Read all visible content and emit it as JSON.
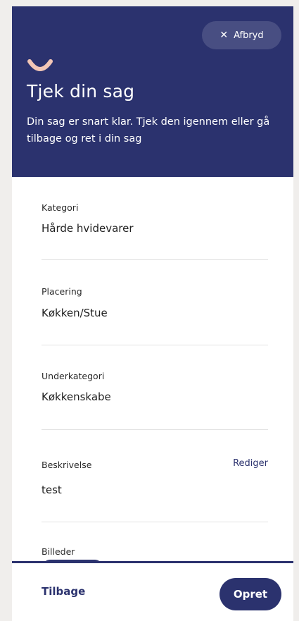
{
  "header": {
    "cancel_label": "Afbryd",
    "title": "Tjek din sag",
    "subtitle": "Din sag er snart klar. Tjek den igennem eller gå tilbage og ret i din sag"
  },
  "fields": [
    {
      "label": "Kategori",
      "value": "Hårde hvidevarer"
    },
    {
      "label": "Placering",
      "value": "Køkken/Stue"
    },
    {
      "label": "Underkategori",
      "value": "Køkkenskabe"
    },
    {
      "label": "Beskrivelse",
      "value": "test",
      "edit_label": "Rediger"
    },
    {
      "label": "Billeder"
    }
  ],
  "footer": {
    "back_label": "Tilbage",
    "create_label": "Opret"
  },
  "colors": {
    "brand": "#2b326e",
    "accent": "#f2c6b6",
    "background": "#f0eeec"
  }
}
